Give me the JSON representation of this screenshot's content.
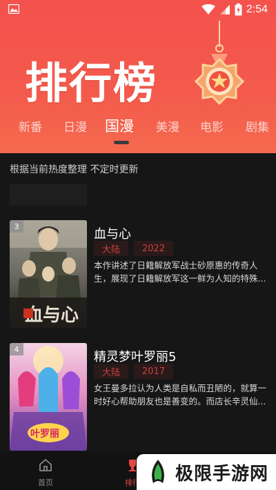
{
  "status": {
    "time": "2:54"
  },
  "header": {
    "title": "排行榜",
    "tabs": [
      {
        "label": "新番",
        "active": false
      },
      {
        "label": "日漫",
        "active": false
      },
      {
        "label": "国漫",
        "active": true
      },
      {
        "label": "美漫",
        "active": false
      },
      {
        "label": "电影",
        "active": false
      },
      {
        "label": "剧集",
        "active": false
      }
    ]
  },
  "list": {
    "subtitle": "根据当前热度整理  不定时更新",
    "items": [
      {
        "rank": "3",
        "title": "血与心",
        "region": "大陆",
        "year": "2022",
        "description": "本作讲述了日籍解放军战士砂原惠的传奇人生，展现了日籍解放军这一鲜为人知的特殊..."
      },
      {
        "rank": "4",
        "title": "精灵梦叶罗丽5",
        "region": "大陆",
        "year": "2017",
        "description": "女王曼多拉认为人类是自私而丑陋的，就算一时好心帮助朋友也是善变的。而店长辛灵仙..."
      }
    ]
  },
  "bottom_nav": [
    {
      "label": "首页",
      "icon": "home-icon"
    },
    {
      "label": "排行",
      "icon": "rank-icon"
    }
  ],
  "watermark": {
    "text": "极限手游网"
  },
  "colors": {
    "header": "#f4524d",
    "tag_text": "#c9403b",
    "background": "#161616"
  }
}
